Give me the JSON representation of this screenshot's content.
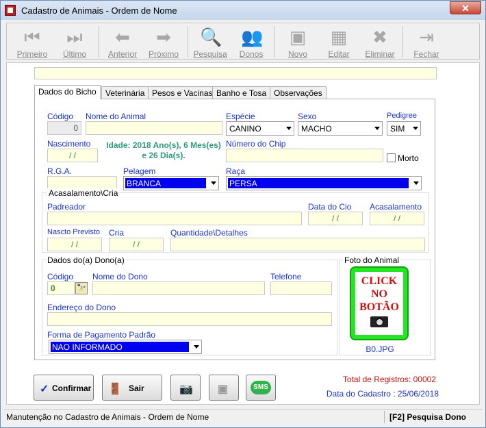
{
  "window": {
    "title": "Cadastro de Animais - Ordem de Nome",
    "close": "✕"
  },
  "toolbar": [
    {
      "label": "Primeiro",
      "icon": "⏮"
    },
    {
      "label": "Último",
      "icon": "⏭"
    },
    {
      "label": "Anterior",
      "icon": "⬅"
    },
    {
      "label": "Próximo",
      "icon": "➡"
    },
    {
      "label": "Pesquisa",
      "icon": "🔍"
    },
    {
      "label": "Donos",
      "icon": "👥"
    },
    {
      "label": "Novo",
      "icon": "▣"
    },
    {
      "label": "Editar",
      "icon": "▦"
    },
    {
      "label": "Eliminar",
      "icon": "✖"
    },
    {
      "label": "Fechar",
      "icon": "⇥"
    }
  ],
  "tabs": [
    "Dados do Bicho",
    "Veterinária",
    "Pesos e Vacinas",
    "Banho e Tosa",
    "Observações"
  ],
  "form": {
    "codigo_label": "Código",
    "codigo_value": "0",
    "nome_label": "Nome do Animal",
    "especie_label": "Espécie",
    "especie_value": "CANINO",
    "sexo_label": "Sexo",
    "sexo_value": "MACHO",
    "pedigree_label": "Pedigree",
    "pedigree_value": "SIM",
    "nascimento_label": "Nascimento",
    "nascimento_value": " / /",
    "idade_line1": "Idade: 2018 Ano(s), 6 Mes(es)",
    "idade_line2": "e 26 Dia(s).",
    "chip_label": "Número do Chip",
    "morto_label": "Morto",
    "rga_label": "R.G.A.",
    "pelagem_label": "Pelagem",
    "pelagem_value": "BRANCA",
    "raca_label": "Raça",
    "raca_value": "PERSA",
    "acasalamento_group": "Acasalamento\\Cria",
    "padreador_label": "Padreador",
    "datacio_label": "Data do Cio",
    "datacio_value": " / /",
    "acasalamento_label": "Acasalamento",
    "acasalamento_value": " / /",
    "nascto_label": "Nascto Previsto",
    "nascto_value": " / /",
    "cria_label": "Cria",
    "cria_value": " / /",
    "quantidade_label": "Quantidade\\Detalhes",
    "dono_group": "Dados do(a) Dono(a)",
    "dono_codigo_label": "Código",
    "dono_codigo_value": "0",
    "dono_nome_label": "Nome do Dono",
    "telefone_label": "Telefone",
    "endereco_label": "Endereço do Dono",
    "pagamento_label": "Forma de Pagamento Padrão",
    "pagamento_value": "NAO INFORMADO",
    "foto_group": "Foto do Animal",
    "foto_text1": "CLICK",
    "foto_text2": "NO",
    "foto_text3": "BOTÃO",
    "foto_file": "B0.JPG"
  },
  "buttons": {
    "confirmar": "Confirmar",
    "sair": "Sair",
    "sms": "SMS"
  },
  "info": {
    "total": "Total de Registros: 00002",
    "data": "Data do Cadastro : 25/06/2018"
  },
  "status": {
    "left": "Manutenção no Cadastro de Animais - Ordem de Nome",
    "right": "[F2] Pesquisa Dono"
  }
}
